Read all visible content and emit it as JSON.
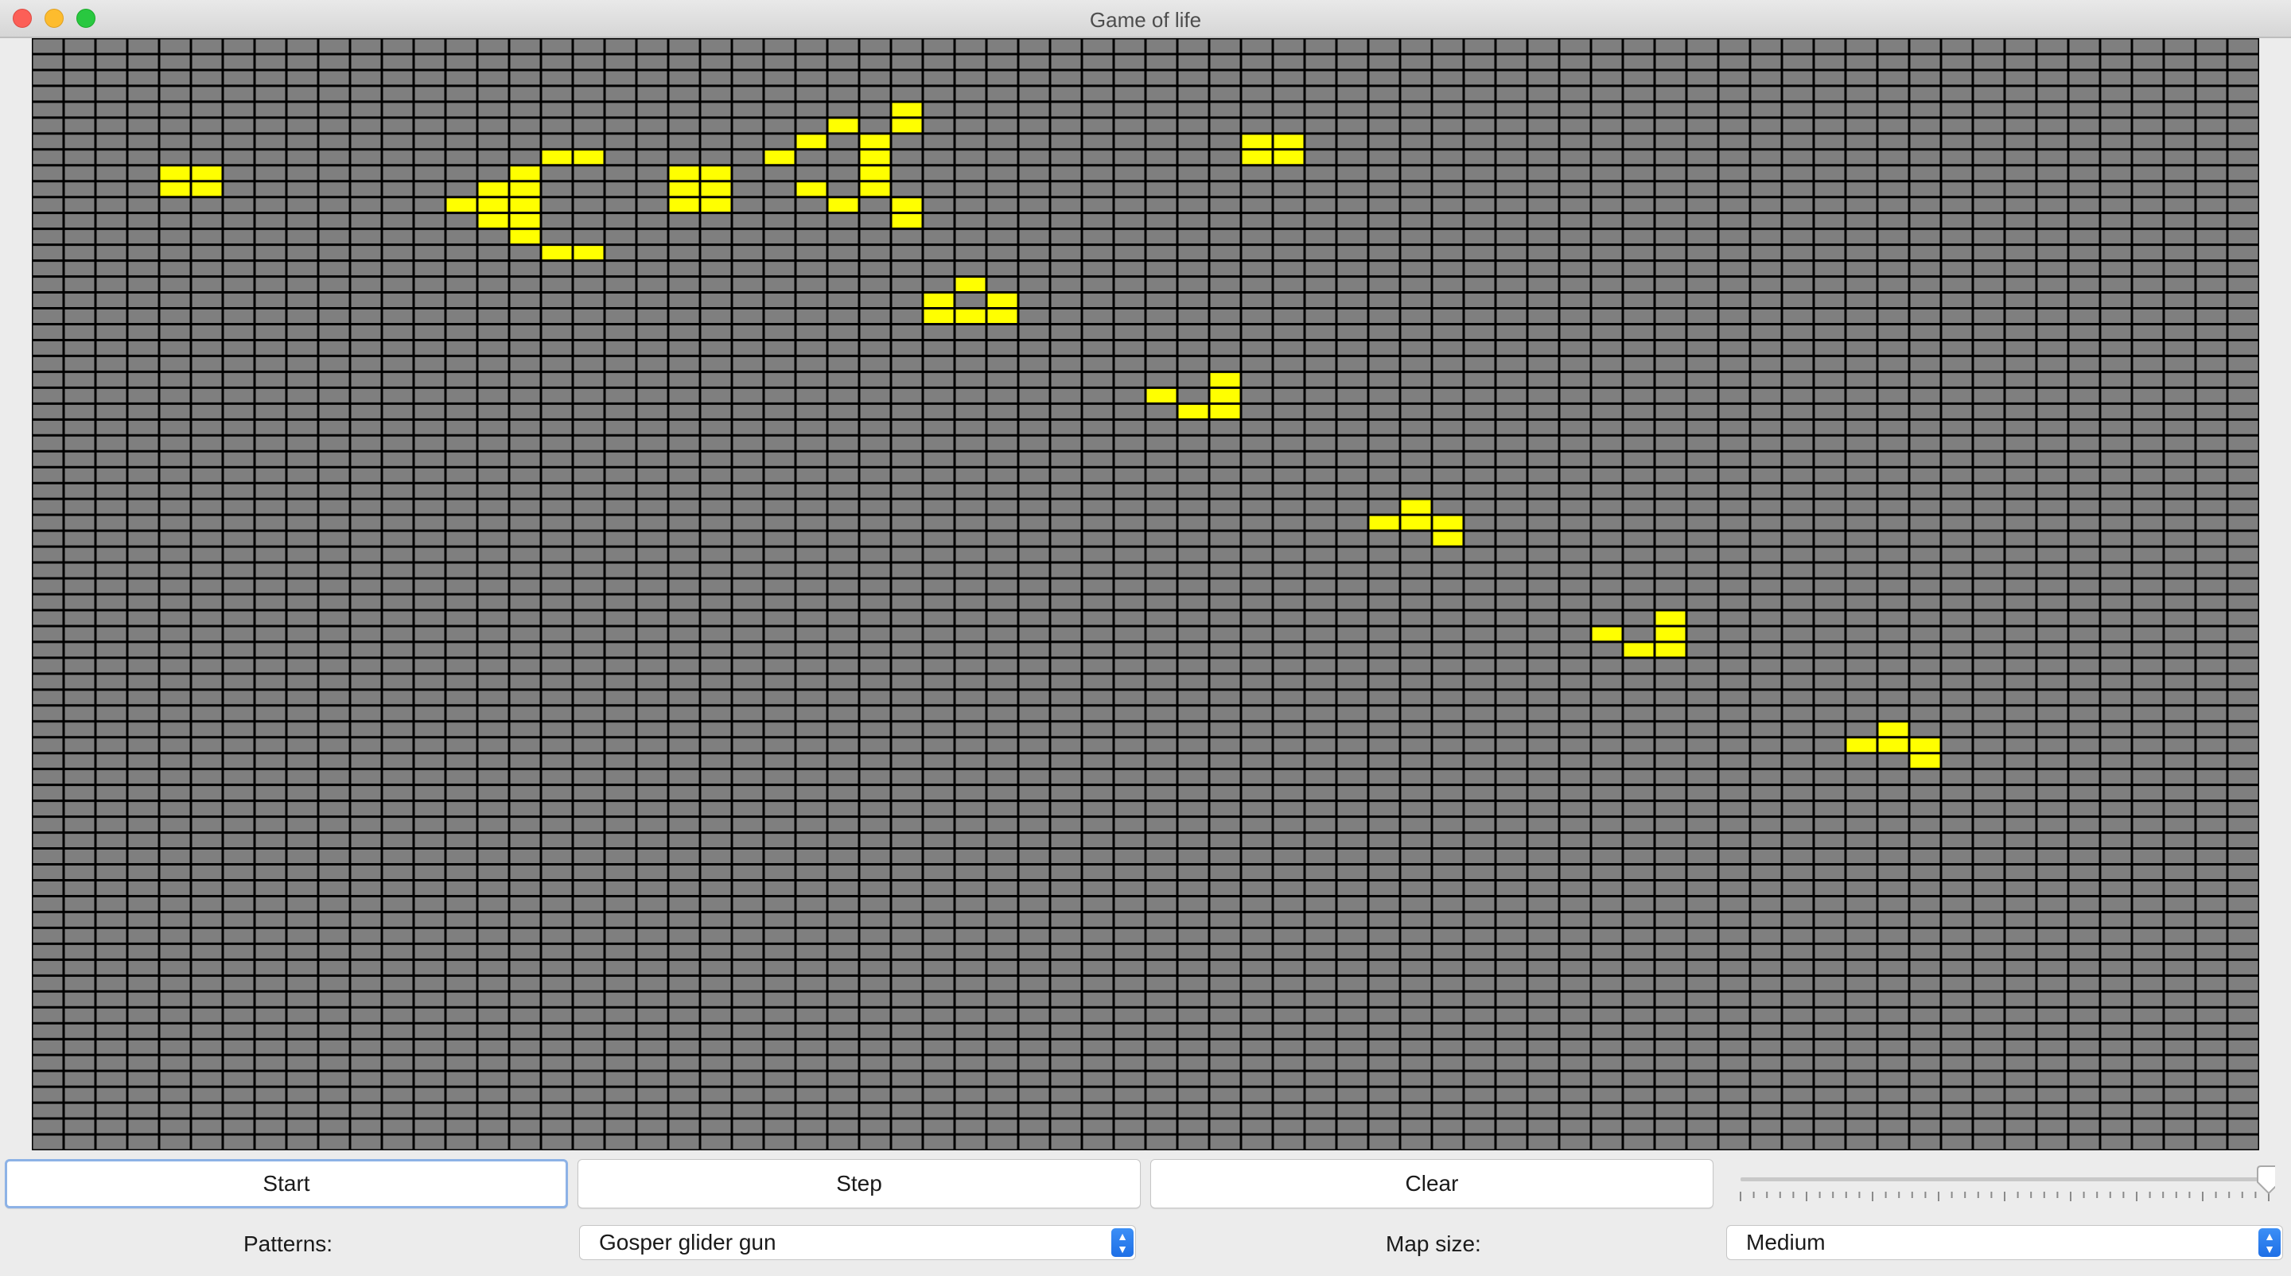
{
  "window": {
    "title": "Game of life"
  },
  "controls": {
    "start_label": "Start",
    "step_label": "Step",
    "clear_label": "Clear",
    "speed_slider": {
      "value_fraction": 1.0,
      "ticks": 41
    },
    "patterns_label": "Patterns:",
    "patterns_value": "Gosper glider gun",
    "mapsize_label": "Map size:",
    "mapsize_value": "Medium"
  },
  "grid": {
    "columns": 70,
    "rows": 70,
    "live_cells": [
      [
        4,
        8
      ],
      [
        5,
        8
      ],
      [
        4,
        9
      ],
      [
        5,
        9
      ],
      [
        13,
        10
      ],
      [
        14,
        9
      ],
      [
        14,
        10
      ],
      [
        14,
        11
      ],
      [
        15,
        8
      ],
      [
        15,
        9
      ],
      [
        15,
        10
      ],
      [
        15,
        11
      ],
      [
        15,
        12
      ],
      [
        16,
        7
      ],
      [
        16,
        13
      ],
      [
        17,
        7
      ],
      [
        17,
        13
      ],
      [
        20,
        8
      ],
      [
        21,
        8
      ],
      [
        20,
        9
      ],
      [
        21,
        9
      ],
      [
        20,
        10
      ],
      [
        21,
        10
      ],
      [
        23,
        7
      ],
      [
        24,
        6
      ],
      [
        24,
        9
      ],
      [
        25,
        5
      ],
      [
        25,
        10
      ],
      [
        26,
        6
      ],
      [
        26,
        7
      ],
      [
        26,
        8
      ],
      [
        26,
        9
      ],
      [
        27,
        4
      ],
      [
        27,
        5
      ],
      [
        27,
        10
      ],
      [
        27,
        11
      ],
      [
        38,
        6
      ],
      [
        39,
        6
      ],
      [
        38,
        7
      ],
      [
        39,
        7
      ],
      [
        28,
        16
      ],
      [
        28,
        17
      ],
      [
        29,
        15
      ],
      [
        29,
        17
      ],
      [
        30,
        16
      ],
      [
        30,
        17
      ],
      [
        35,
        22
      ],
      [
        36,
        23
      ],
      [
        37,
        21
      ],
      [
        37,
        22
      ],
      [
        37,
        23
      ],
      [
        42,
        30
      ],
      [
        43,
        29
      ],
      [
        43,
        30
      ],
      [
        44,
        30
      ],
      [
        44,
        31
      ],
      [
        49,
        37
      ],
      [
        50,
        38
      ],
      [
        51,
        36
      ],
      [
        51,
        37
      ],
      [
        51,
        38
      ],
      [
        57,
        44
      ],
      [
        58,
        43
      ],
      [
        58,
        44
      ],
      [
        59,
        44
      ],
      [
        59,
        45
      ]
    ],
    "colors": {
      "dead": "#7f7f7f",
      "live": "#ffff00",
      "line": "#000000"
    }
  }
}
